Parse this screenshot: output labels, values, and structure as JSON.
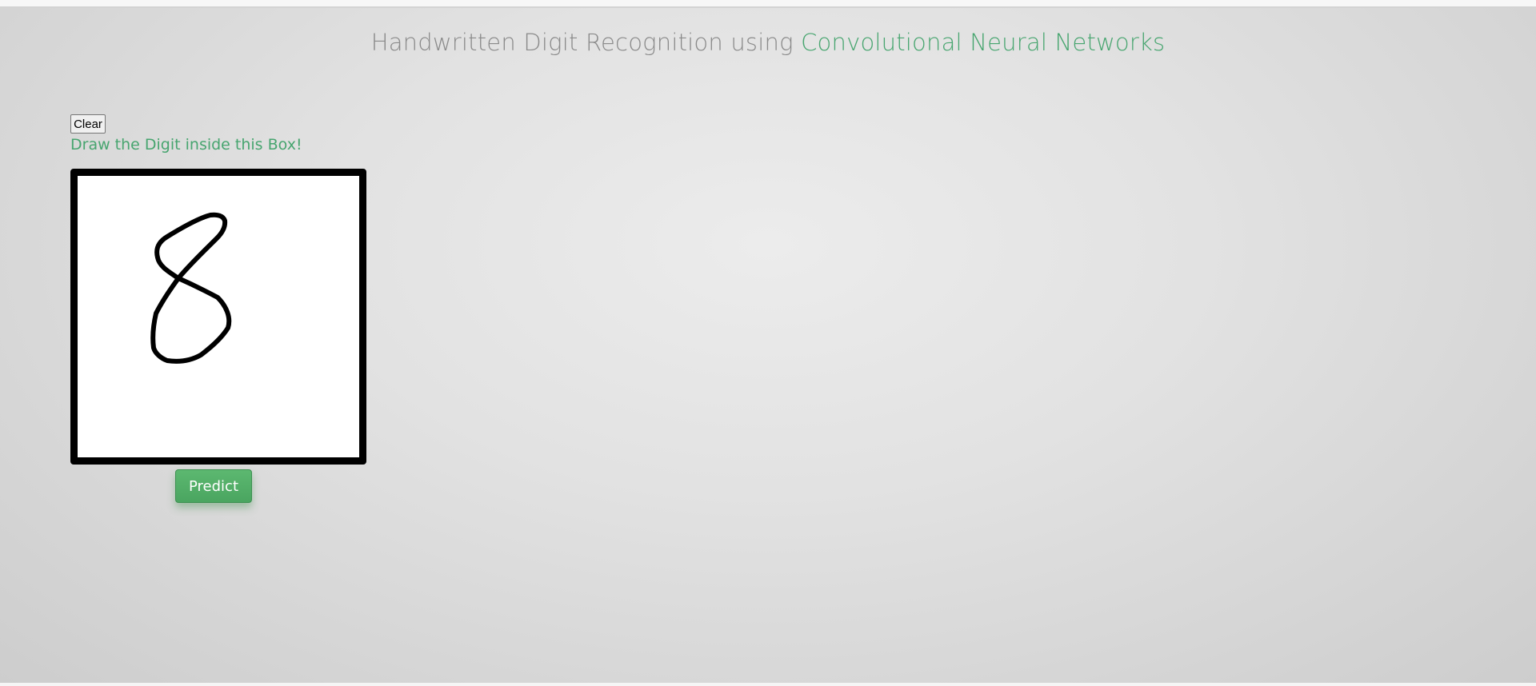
{
  "header": {
    "title_prefix": "Handwritten Digit Recognition using ",
    "title_highlight": "Convolutional Neural Networks"
  },
  "controls": {
    "clear_label": "Clear",
    "instruction": "Draw the Digit inside this Box!",
    "predict_label": "Predict"
  },
  "canvas": {
    "drawn_digit_shape": "8"
  },
  "colors": {
    "accent": "#47a56f",
    "title_gray": "#8a8a8a",
    "button_green": "#5cb870",
    "canvas_border": "#000000",
    "canvas_background": "#ffffff"
  }
}
